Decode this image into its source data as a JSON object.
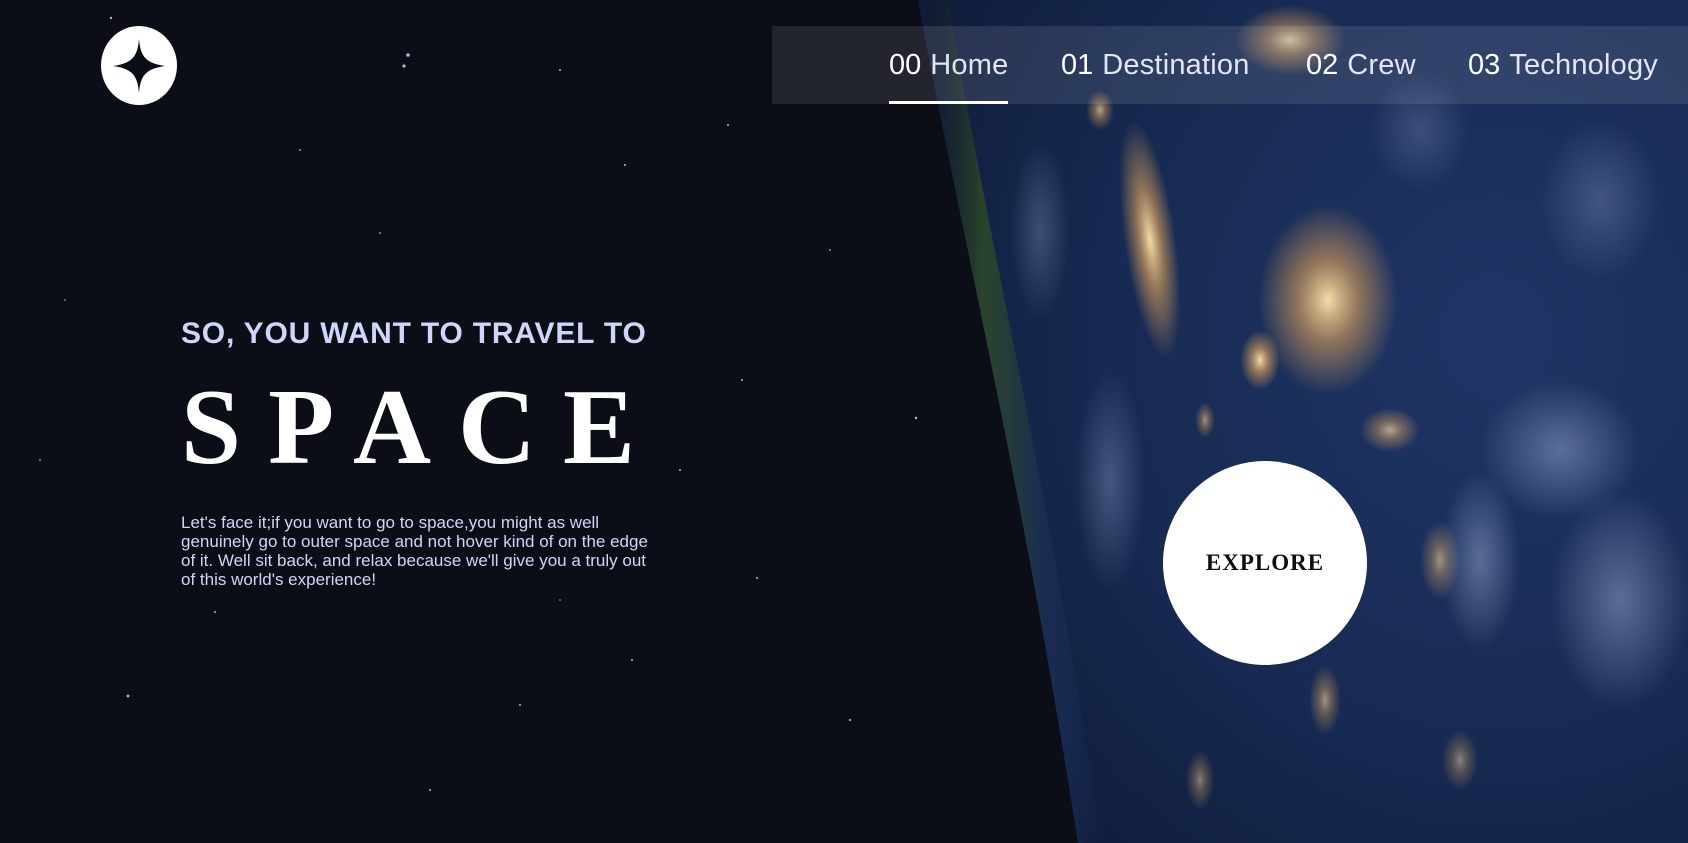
{
  "logo": {
    "icon": "four-point-star-icon"
  },
  "nav": {
    "items": [
      {
        "number": "00",
        "label": "Home",
        "active": true
      },
      {
        "number": "01",
        "label": "Destination",
        "active": false
      },
      {
        "number": "02",
        "label": "Crew",
        "active": false
      },
      {
        "number": "03",
        "label": "Technology",
        "active": false
      }
    ]
  },
  "hero": {
    "kicker": "SO, YOU WANT TO TRAVEL TO",
    "headline": "SPACE",
    "body": "Let's face it;if you want to go to space,you might as well genuinely go to outer space and not hover kind of on the edge of it. Well sit back, and relax because we'll give you a truly out of this world's experience!",
    "cta": "EXPLORE"
  },
  "colors": {
    "background": "#0b0d17",
    "text": "#ffffff",
    "muted": "#d0d6f9"
  }
}
